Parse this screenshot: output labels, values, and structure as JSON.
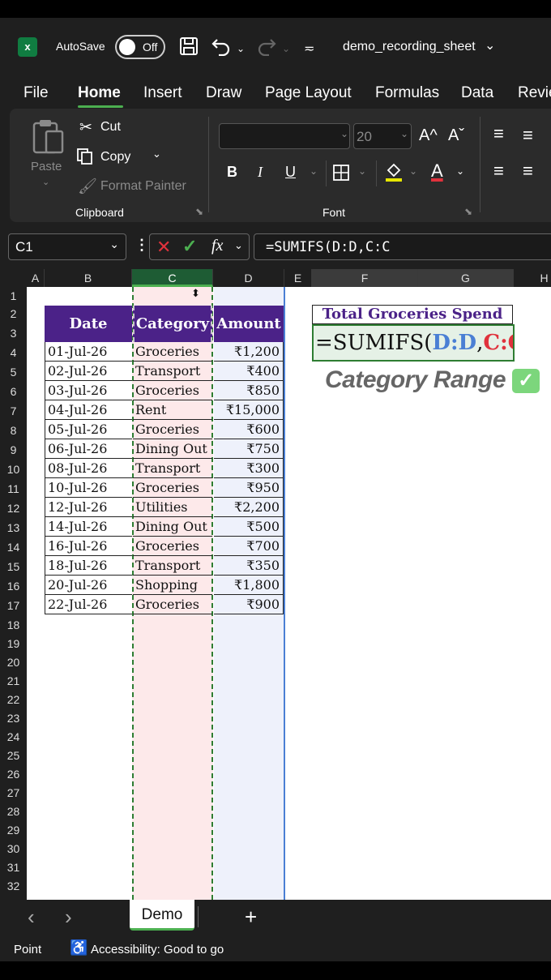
{
  "titlebar": {
    "autosave_label": "AutoSave",
    "toggle_label": "Off",
    "filename": "demo_recording_sheet"
  },
  "menu": [
    "File",
    "Home",
    "Insert",
    "Draw",
    "Page Layout",
    "Formulas",
    "Data",
    "Revie"
  ],
  "ribbon": {
    "clipboard": {
      "paste": "Paste",
      "cut": "Cut",
      "copy": "Copy",
      "format_painter": "Format Painter",
      "label": "Clipboard"
    },
    "font": {
      "size": "20",
      "bold": "B",
      "italic": "I",
      "underline": "U",
      "grow": "A^",
      "shrink": "Aˇ",
      "color": "A",
      "label": "Font"
    }
  },
  "formula_bar": {
    "name_box": "C1",
    "cancel": "✕",
    "confirm": "✓",
    "fx": "fx",
    "formula": "=SUMIFS(D:D,C:C"
  },
  "columns": [
    "A",
    "B",
    "C",
    "D",
    "E",
    "F",
    "G",
    "H"
  ],
  "rows": [
    "1",
    "2",
    "3",
    "4",
    "5",
    "6",
    "7",
    "8",
    "9",
    "10",
    "11",
    "12",
    "13",
    "14",
    "15",
    "16",
    "17",
    "18",
    "19",
    "20",
    "21",
    "22",
    "23",
    "24",
    "25",
    "26",
    "27",
    "28",
    "29",
    "30",
    "31",
    "32"
  ],
  "table": {
    "headers": [
      "Date",
      "Category",
      "Amount"
    ],
    "rows": [
      [
        "01-Jul-26",
        "Groceries",
        "₹1,200"
      ],
      [
        "02-Jul-26",
        "Transport",
        "₹400"
      ],
      [
        "03-Jul-26",
        "Groceries",
        "₹850"
      ],
      [
        "04-Jul-26",
        "Rent",
        "₹15,000"
      ],
      [
        "05-Jul-26",
        "Groceries",
        "₹600"
      ],
      [
        "06-Jul-26",
        "Dining Out",
        "₹750"
      ],
      [
        "08-Jul-26",
        "Transport",
        "₹300"
      ],
      [
        "10-Jul-26",
        "Groceries",
        "₹950"
      ],
      [
        "12-Jul-26",
        "Utilities",
        "₹2,200"
      ],
      [
        "14-Jul-26",
        "Dining Out",
        "₹500"
      ],
      [
        "16-Jul-26",
        "Groceries",
        "₹700"
      ],
      [
        "18-Jul-26",
        "Transport",
        "₹350"
      ],
      [
        "20-Jul-26",
        "Shopping",
        "₹1,800"
      ],
      [
        "22-Jul-26",
        "Groceries",
        "₹900"
      ]
    ]
  },
  "summary": {
    "title": "Total Groceries Spend",
    "edit_prefix": "=SUMIFS(",
    "edit_d": "D:D",
    "edit_comma": ",",
    "edit_c": "C:C",
    "note": "Category Range",
    "check": "✓"
  },
  "colors": {
    "header_purple": "#4b2288",
    "ref_blue": "#4a7fd4",
    "ref_red": "#e0323c",
    "excel_green": "#107c41"
  },
  "sheet_tabs": {
    "active": "Demo",
    "add": "+",
    "prev": "‹",
    "next": "›"
  },
  "status": {
    "mode": "Point",
    "accessibility": "Accessibility: Good to go"
  }
}
